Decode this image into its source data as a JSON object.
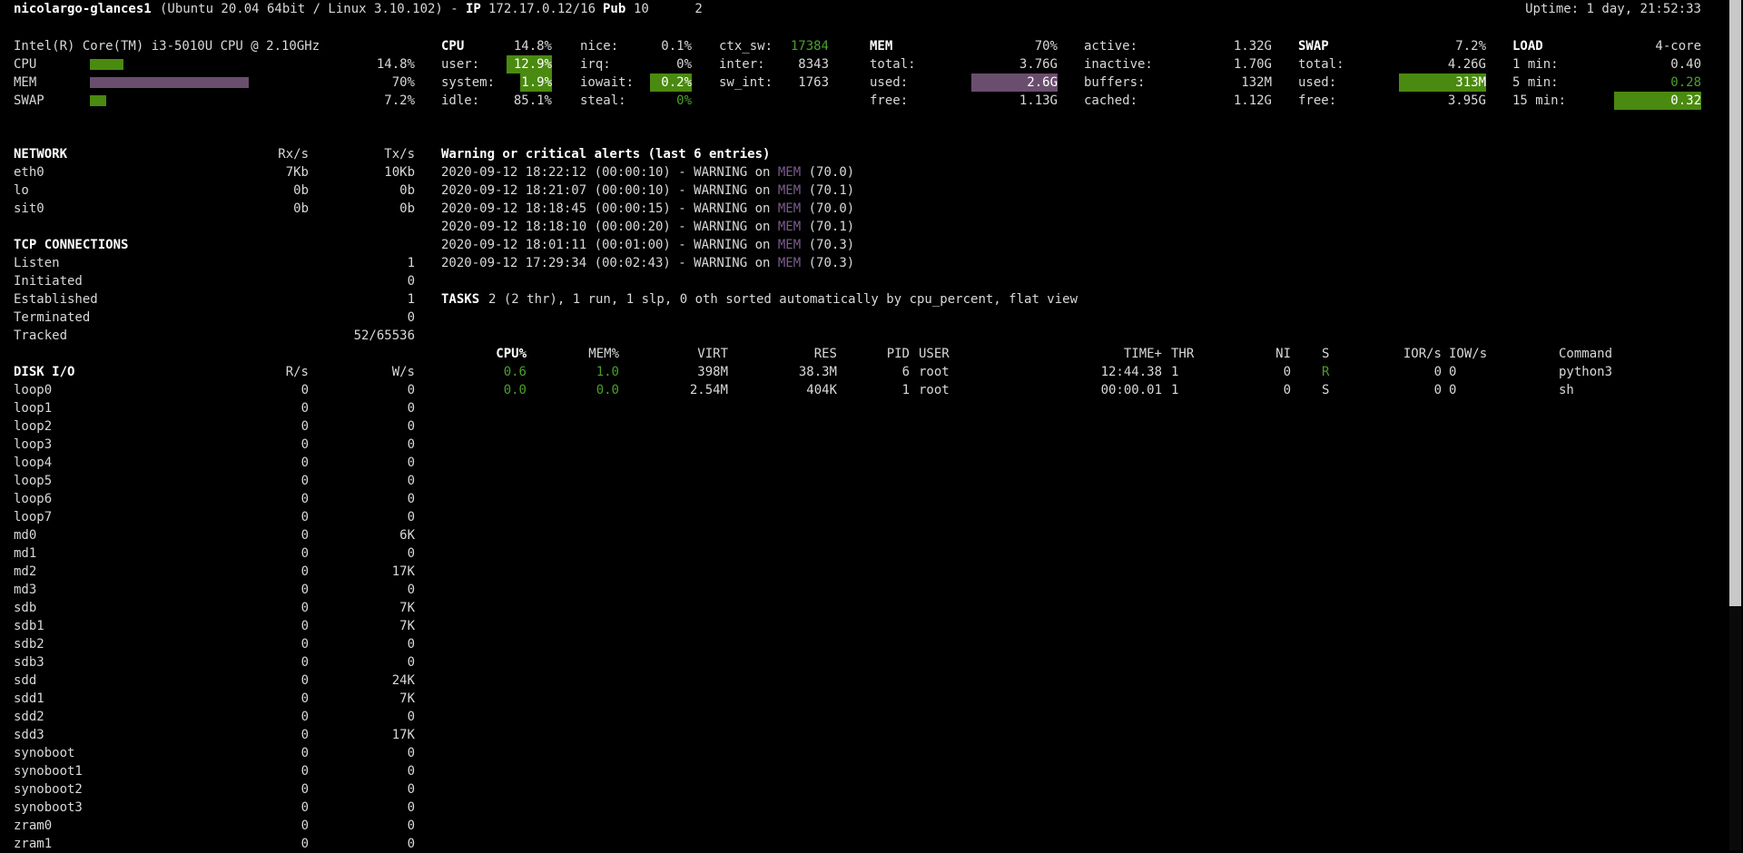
{
  "header": {
    "hostname": "nicolargo-glances1",
    "os": "(Ubuntu 20.04 64bit / Linux 3.10.102) -",
    "ip_label": "IP",
    "ip": "172.17.0.12/16",
    "pub_label": "Pub",
    "pub_ip": "10      2",
    "uptime": "Uptime: 1 day, 21:52:33"
  },
  "cpu_summary": {
    "model": "Intel(R) Core(TM) i3-5010U CPU @ 2.10GHz",
    "rows": [
      {
        "label": "CPU",
        "value": "14.8%",
        "fraction": 0.148
      },
      {
        "label": "MEM",
        "value": "70%",
        "fraction": 0.7
      },
      {
        "label": "SWAP",
        "value": "7.2%",
        "fraction": 0.072
      }
    ]
  },
  "cpu": {
    "title": "CPU",
    "total": "14.8%",
    "user_label": "user:",
    "user": "12.9%",
    "system_label": "system:",
    "system": "1.9%",
    "idle_label": "idle:",
    "idle": "85.1%",
    "nice_label": "nice:",
    "nice": "0.1%",
    "irq_label": "irq:",
    "irq": "0%",
    "iowait_label": "iowait:",
    "iowait": "0.2%",
    "steal_label": "steal:",
    "steal": "0%",
    "ctx_sw_label": "ctx_sw:",
    "ctx_sw": "17384",
    "inter_label": "inter:",
    "inter": "8343",
    "sw_int_label": "sw_int:",
    "sw_int": "1763"
  },
  "mem": {
    "title": "MEM",
    "percent": "70%",
    "total_label": "total:",
    "total": "3.76G",
    "used_label": "used:",
    "used": "2.6G",
    "free_label": "free:",
    "free": "1.13G",
    "active_label": "active:",
    "active": "1.32G",
    "inactive_label": "inactive:",
    "inactive": "1.70G",
    "buffers_label": "buffers:",
    "buffers": "132M",
    "cached_label": "cached:",
    "cached": "1.12G"
  },
  "swap": {
    "title": "SWAP",
    "percent": "7.2%",
    "total_label": "total:",
    "total": "4.26G",
    "used_label": "used:",
    "used": "313M",
    "free_label": "free:",
    "free": "3.95G"
  },
  "load": {
    "title": "LOAD",
    "cores": "4-core",
    "min1_label": "1 min:",
    "min1": "0.40",
    "min5_label": "5 min:",
    "min5": "0.28",
    "min15_label": "15 min:",
    "min15": "0.32"
  },
  "network": {
    "title": "NETWORK",
    "rx_header": "Rx/s",
    "tx_header": "Tx/s",
    "rows": [
      {
        "name": "eth0",
        "rx": "7Kb",
        "tx": "10Kb"
      },
      {
        "name": "lo",
        "rx": "0b",
        "tx": "0b"
      },
      {
        "name": "sit0",
        "rx": "0b",
        "tx": "0b"
      }
    ]
  },
  "tcp": {
    "title": "TCP CONNECTIONS",
    "rows": [
      {
        "name": "Listen",
        "value": "1"
      },
      {
        "name": "Initiated",
        "value": "0"
      },
      {
        "name": "Established",
        "value": "1"
      },
      {
        "name": "Terminated",
        "value": "0"
      },
      {
        "name": "Tracked",
        "value": "52/65536"
      }
    ]
  },
  "disk": {
    "title": "DISK I/O",
    "r_header": "R/s",
    "w_header": "W/s",
    "rows": [
      {
        "name": "loop0",
        "r": "0",
        "w": "0"
      },
      {
        "name": "loop1",
        "r": "0",
        "w": "0"
      },
      {
        "name": "loop2",
        "r": "0",
        "w": "0"
      },
      {
        "name": "loop3",
        "r": "0",
        "w": "0"
      },
      {
        "name": "loop4",
        "r": "0",
        "w": "0"
      },
      {
        "name": "loop5",
        "r": "0",
        "w": "0"
      },
      {
        "name": "loop6",
        "r": "0",
        "w": "0"
      },
      {
        "name": "loop7",
        "r": "0",
        "w": "0"
      },
      {
        "name": "md0",
        "r": "0",
        "w": "6K"
      },
      {
        "name": "md1",
        "r": "0",
        "w": "0"
      },
      {
        "name": "md2",
        "r": "0",
        "w": "17K"
      },
      {
        "name": "md3",
        "r": "0",
        "w": "0"
      },
      {
        "name": "sdb",
        "r": "0",
        "w": "7K"
      },
      {
        "name": "sdb1",
        "r": "0",
        "w": "7K"
      },
      {
        "name": "sdb2",
        "r": "0",
        "w": "0"
      },
      {
        "name": "sdb3",
        "r": "0",
        "w": "0"
      },
      {
        "name": "sdd",
        "r": "0",
        "w": "24K"
      },
      {
        "name": "sdd1",
        "r": "0",
        "w": "7K"
      },
      {
        "name": "sdd2",
        "r": "0",
        "w": "0"
      },
      {
        "name": "sdd3",
        "r": "0",
        "w": "17K"
      },
      {
        "name": "synoboot",
        "r": "0",
        "w": "0"
      },
      {
        "name": "synoboot1",
        "r": "0",
        "w": "0"
      },
      {
        "name": "synoboot2",
        "r": "0",
        "w": "0"
      },
      {
        "name": "synoboot3",
        "r": "0",
        "w": "0"
      },
      {
        "name": "zram0",
        "r": "0",
        "w": "0"
      },
      {
        "name": "zram1",
        "r": "0",
        "w": "0"
      }
    ]
  },
  "alerts": {
    "title": "Warning or critical alerts (last 6 entries)",
    "rows": [
      {
        "prefix": "2020-09-12 18:22:12 (00:00:10) - WARNING on ",
        "item": "MEM",
        "value": " (70.0)"
      },
      {
        "prefix": "2020-09-12 18:21:07 (00:00:10) - WARNING on ",
        "item": "MEM",
        "value": " (70.1)"
      },
      {
        "prefix": "2020-09-12 18:18:45 (00:00:15) - WARNING on ",
        "item": "MEM",
        "value": " (70.0)"
      },
      {
        "prefix": "2020-09-12 18:18:10 (00:00:20) - WARNING on ",
        "item": "MEM",
        "value": " (70.1)"
      },
      {
        "prefix": "2020-09-12 18:01:11 (00:01:00) - WARNING on ",
        "item": "MEM",
        "value": " (70.3)"
      },
      {
        "prefix": "2020-09-12 17:29:34 (00:02:43) - WARNING on ",
        "item": "MEM",
        "value": " (70.3)"
      }
    ]
  },
  "tasks": {
    "label": "TASKS",
    "summary": "2 (2 thr), 1 run, 1 slp, 0 oth sorted automatically by cpu_percent, flat view"
  },
  "processes": {
    "headers": {
      "cpu": "CPU%",
      "mem": "MEM%",
      "virt": "VIRT",
      "res": "RES",
      "pid": "PID",
      "user": "USER",
      "time": "TIME+",
      "thr": "THR",
      "ni": "NI",
      "s": "S",
      "ior": "IOR/s",
      "iow": "IOW/s",
      "cmd": "Command"
    },
    "rows": [
      {
        "cpu": "0.6",
        "mem": "1.0",
        "virt": "398M",
        "res": "38.3M",
        "pid": "6",
        "user": "root",
        "time": "12:44.38",
        "thr": "1",
        "ni": "0",
        "s": "R",
        "ior": "0",
        "iow": "0",
        "cmd": "python3"
      },
      {
        "cpu": "0.0",
        "mem": "0.0",
        "virt": "2.54M",
        "res": "404K",
        "pid": "1",
        "user": "root",
        "time": "00:00.01",
        "thr": "1",
        "ni": "0",
        "s": "S",
        "ior": "0",
        "iow": "0",
        "cmd": "sh"
      }
    ]
  },
  "colors": {
    "ok": "#4aa02c",
    "careful": "#7c5b8c",
    "bar_green": "#4a8a10",
    "bar_purple": "#6a4e6e"
  }
}
